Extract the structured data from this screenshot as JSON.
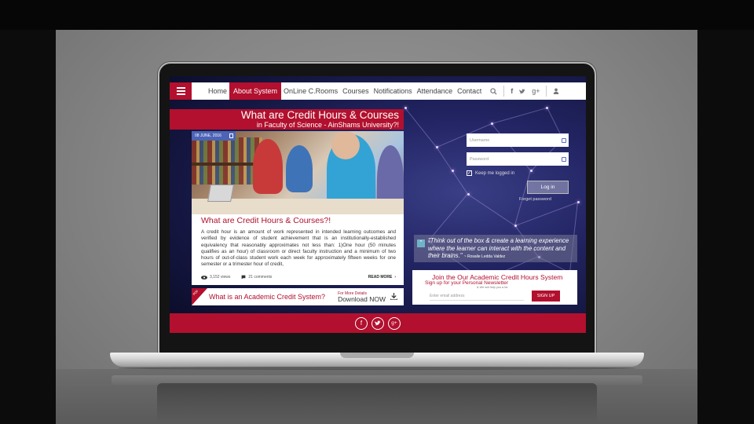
{
  "nav": {
    "items": [
      {
        "label": "Home"
      },
      {
        "label": "About System",
        "active": true
      },
      {
        "label": "OnLine C.Rooms"
      },
      {
        "label": "Courses"
      },
      {
        "label": "Notifications"
      },
      {
        "label": "Attendance"
      },
      {
        "label": "Contact"
      }
    ],
    "icons": [
      "search-icon",
      "facebook-icon",
      "twitter-icon",
      "google-plus-icon",
      "user-icon"
    ]
  },
  "title": {
    "main": "What are Credit Hours & Courses",
    "sub": "in Faculty of Science - AinShams University?!"
  },
  "article": {
    "date": "08 JUNE, 2016",
    "heading": "What are Credit Hours & Courses?!",
    "body": "A credit hour is an amount of work represented in intended learning outcomes and verified by evidence of student achievement that is an institutionally-established equivalency that reasonably approximates not less than: 1)One hour (50 minutes qualifies as an hour) of classroom or direct faculty instruction and a minimum of two hours of out-of-class student work each week for approximately fifteen weeks for one semester or a trimester hour of credit,",
    "views": "3,152 views",
    "comments": "21 comments",
    "read_more": "READ MORE"
  },
  "download": {
    "ribbon": "PDF",
    "text": "What is an Academic Credit System?",
    "small": "For More Details",
    "big": "Download NOW"
  },
  "login": {
    "username_placeholder": "Username",
    "password_placeholder": "Password",
    "keep": "Keep me logged in",
    "button": "Log in",
    "forgot": "Forget password"
  },
  "quote": {
    "text": "\"Think out of the box & create a learning experience where the learner can interact with the content and their brains.\"",
    "author": "~ Rosalie Ledda Valdez"
  },
  "newsletter": {
    "title": "Join the Our Academic Credit Hours System",
    "sub": "Sign up for your Personal Newsletter",
    "small": "& We will help you a lot.",
    "placeholder": "Enter email address",
    "button": "SIGN UP"
  },
  "footer": {
    "icons": [
      "facebook-icon",
      "twitter-icon",
      "google-plus-icon"
    ]
  },
  "colors": {
    "brand": "#b2102e",
    "accent_blue": "#4c63b6"
  }
}
